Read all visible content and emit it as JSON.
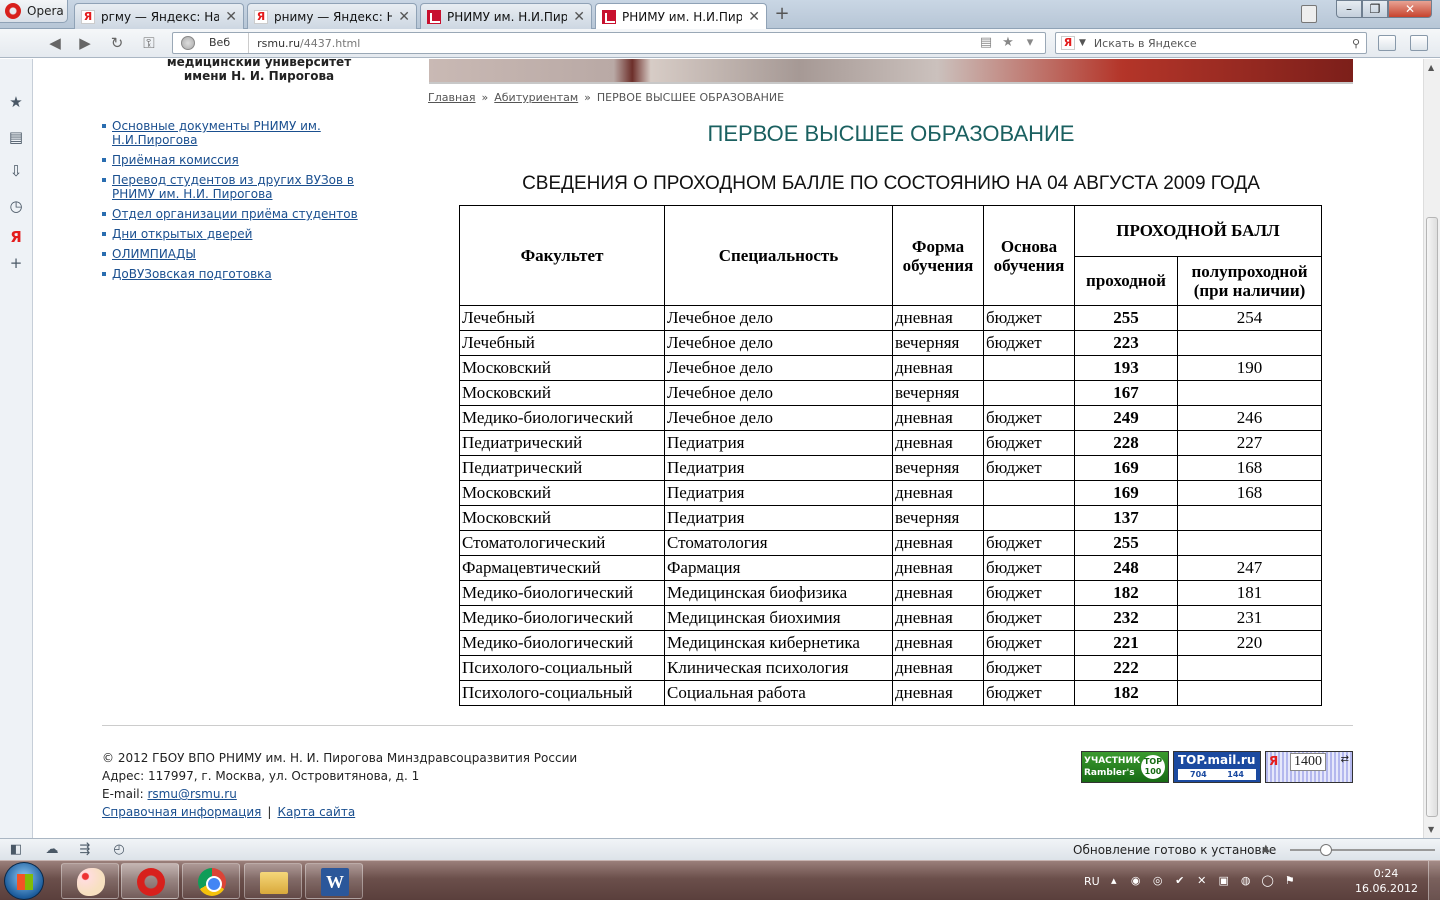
{
  "browser": {
    "menu_label": "Opera",
    "tabs": [
      {
        "title": "ргму — Яндекс: Нашл...",
        "favicon": "yandex-icon",
        "active": false
      },
      {
        "title": "рниму — Яндекс: На......",
        "favicon": "yandex-icon",
        "active": false
      },
      {
        "title": "РНИМУ им. Н.И.Пиро...",
        "favicon": "rsmu-icon",
        "active": false
      },
      {
        "title": "РНИМУ им. Н.И.Пиро...",
        "favicon": "rsmu-icon",
        "active": true
      }
    ],
    "address": {
      "mode_label": "Веб",
      "url_host": "rsmu.ru",
      "url_path": "/4437.html"
    },
    "search": {
      "placeholder": "Искать в Яндексе"
    }
  },
  "page": {
    "logo_lines": [
      "медицинский университет",
      "имени Н. И. Пирогова"
    ],
    "left_menu": [
      "Основные документы РНИМУ им. Н.И.Пирогова",
      "Приёмная комиссия",
      "Перевод студентов из других ВУЗов в РНИМУ им. Н.И. Пирогова",
      "Отдел организации приёма студентов",
      "Дни открытых дверей",
      "ОЛИМПИАДЫ",
      "ДоВУЗовская подготовка"
    ],
    "breadcrumb": {
      "home": "Главная",
      "section": "Абитуриентам",
      "current": "ПЕРВОЕ ВЫСШЕЕ ОБРАЗОВАНИЕ",
      "separator": "»"
    },
    "title": "ПЕРВОЕ ВЫСШЕЕ ОБРАЗОВАНИЕ",
    "table_caption": "СВЕДЕНИЯ О ПРОХОДНОМ БАЛЛЕ ПО СОСТОЯНИЮ НА 04 АВГУСТА 2009 ГОДА",
    "table": {
      "headers": {
        "faculty": "Факультет",
        "specialty": "Специальность",
        "form_line1": "Форма",
        "form_line2": "обучения",
        "basis_line1": "Основа",
        "basis_line2": "обучения",
        "score_group": "ПРОХОДНОЙ БАЛЛ",
        "passing": "проходной",
        "semi_line1": "полупроходной",
        "semi_line2": "(при наличии)"
      },
      "rows": [
        [
          "Лечебный",
          "Лечебное дело",
          "дневная",
          "бюджет",
          "255",
          "254"
        ],
        [
          "Лечебный",
          "Лечебное дело",
          "вечерняя",
          "бюджет",
          "223",
          ""
        ],
        [
          "Московский",
          "Лечебное дело",
          "дневная",
          "",
          "193",
          "190"
        ],
        [
          "Московский",
          "Лечебное дело",
          "вечерняя",
          "",
          "167",
          ""
        ],
        [
          "Медико-биологический",
          "Лечебное дело",
          "дневная",
          "бюджет",
          "249",
          "246"
        ],
        [
          "Педиатрический",
          "Педиатрия",
          "дневная",
          "бюджет",
          "228",
          "227"
        ],
        [
          "Педиатрический",
          "Педиатрия",
          "вечерняя",
          "бюджет",
          "169",
          "168"
        ],
        [
          "Московский",
          "Педиатрия",
          "дневная",
          "",
          "169",
          "168"
        ],
        [
          "Московский",
          "Педиатрия",
          "вечерняя",
          "",
          "137",
          ""
        ],
        [
          "Стоматологический",
          "Стоматология",
          "дневная",
          "бюджет",
          "255",
          ""
        ],
        [
          "Фармацевтический",
          "Фармация",
          "дневная",
          "бюджет",
          "248",
          "247"
        ],
        [
          "Медико-биологический",
          "Медицинская биофизика",
          "дневная",
          "бюджет",
          "182",
          "181"
        ],
        [
          "Медико-биологический",
          "Медицинская биохимия",
          "дневная",
          "бюджет",
          "232",
          "231"
        ],
        [
          "Медико-биологический",
          "Медицинская кибернетика",
          "дневная",
          "бюджет",
          "221",
          "220"
        ],
        [
          "Психолого-социальный",
          "Клиническая психология",
          "дневная",
          "бюджет",
          "222",
          ""
        ],
        [
          "Психолого-социальный",
          "Социальная работа",
          "дневная",
          "бюджет",
          "182",
          ""
        ]
      ]
    },
    "footer": {
      "copyright": "© 2012 ГБОУ ВПО РНИМУ им. Н. И. Пирогова Минздравсоцразвития России",
      "address": "Адрес: 117997, г. Москва, ул. Островитянова, д. 1",
      "email_label": "E-mail:",
      "email": "rsmu@rsmu.ru",
      "link_info": "Справочная информация",
      "link_sitemap": "Карта сайта",
      "pipe": "|"
    },
    "counters": {
      "rambler_line1": "УЧАСТНИК",
      "rambler_line2": "Rambler's",
      "rambler_badge_line1": "TOP",
      "rambler_badge_line2": "100",
      "mail_title": "TOP.mail.ru",
      "mail_num1": "704",
      "mail_num2": "144",
      "yandex_letter": "Я",
      "yandex_num": "1400"
    }
  },
  "statusbar": {
    "update_text": "Обновление готово к установке"
  },
  "taskbar": {
    "lang": "RU",
    "time": "0:24",
    "date": "16.06.2012",
    "word_letter": "W"
  }
}
